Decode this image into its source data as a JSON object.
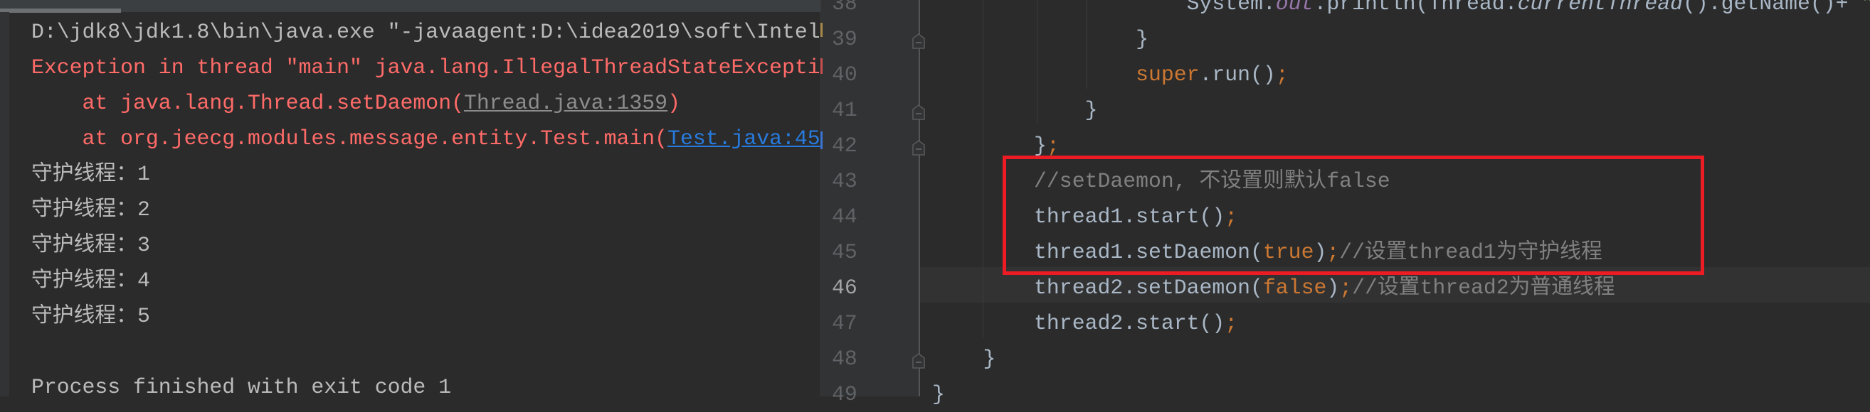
{
  "console": {
    "lines": [
      {
        "parts": [
          {
            "text": "D:\\jdk8\\jdk1.8\\bin\\java.exe \"-javaagent:D:\\idea2019\\soft\\Intel",
            "kind": "normal"
          }
        ]
      },
      {
        "parts": [
          {
            "text": "Exception in thread \"main\" java.lang.IllegalThreadStateException",
            "kind": "error"
          }
        ]
      },
      {
        "parts": [
          {
            "text": "    at java.lang.Thread.setDaemon(",
            "kind": "error"
          },
          {
            "text": "Thread.java:1359",
            "kind": "link-gray"
          },
          {
            "text": ")",
            "kind": "error"
          }
        ]
      },
      {
        "parts": [
          {
            "text": "    at org.jeecg.modules.message.entity.Test.main(",
            "kind": "error"
          },
          {
            "text": "Test.java:45",
            "kind": "link-blue"
          }
        ]
      },
      {
        "parts": [
          {
            "text": "守护线程：1",
            "kind": "normal"
          }
        ]
      },
      {
        "parts": [
          {
            "text": "守护线程：2",
            "kind": "normal"
          }
        ]
      },
      {
        "parts": [
          {
            "text": "守护线程：3",
            "kind": "normal"
          }
        ]
      },
      {
        "parts": [
          {
            "text": "守护线程：4",
            "kind": "normal"
          }
        ]
      },
      {
        "parts": [
          {
            "text": "守护线程：5",
            "kind": "normal"
          }
        ]
      },
      {
        "parts": []
      },
      {
        "parts": [
          {
            "text": "Process finished with exit code 1",
            "kind": "normal"
          }
        ]
      }
    ]
  },
  "editor": {
    "current_line": "46",
    "highlight_box_color": "#ed1c24",
    "lines": [
      {
        "number": "38",
        "fold": false,
        "tokens": [
          {
            "text": "                    System.",
            "kind": "plain"
          },
          {
            "text": "out",
            "kind": "field"
          },
          {
            "text": ".println(Thread.",
            "kind": "plain"
          },
          {
            "text": "currentThread",
            "kind": "italic"
          },
          {
            "text": "().getName()+ ",
            "kind": "plain"
          },
          {
            "text": "\"",
            "kind": "string"
          }
        ]
      },
      {
        "number": "39",
        "fold": true,
        "tokens": [
          {
            "text": "                }",
            "kind": "plain"
          }
        ]
      },
      {
        "number": "40",
        "fold": false,
        "tokens": [
          {
            "text": "                ",
            "kind": "plain"
          },
          {
            "text": "super",
            "kind": "keyword"
          },
          {
            "text": ".run()",
            "kind": "plain"
          },
          {
            "text": ";",
            "kind": "keyword"
          }
        ]
      },
      {
        "number": "41",
        "fold": true,
        "tokens": [
          {
            "text": "            }",
            "kind": "plain"
          }
        ]
      },
      {
        "number": "42",
        "fold": true,
        "tokens": [
          {
            "text": "        }",
            "kind": "plain"
          },
          {
            "text": ";",
            "kind": "keyword"
          }
        ]
      },
      {
        "number": "43",
        "fold": false,
        "tokens": [
          {
            "text": "        //setDaemon, 不设置则默认false",
            "kind": "comment"
          }
        ]
      },
      {
        "number": "44",
        "fold": false,
        "tokens": [
          {
            "text": "        thread1.start()",
            "kind": "plain"
          },
          {
            "text": ";",
            "kind": "keyword"
          }
        ]
      },
      {
        "number": "45",
        "fold": false,
        "tokens": [
          {
            "text": "        thread1.setDaemon(",
            "kind": "plain"
          },
          {
            "text": "true",
            "kind": "keyword"
          },
          {
            "text": ")",
            "kind": "plain"
          },
          {
            "text": ";",
            "kind": "keyword"
          },
          {
            "text": "//设置thread1为守护线程",
            "kind": "comment"
          }
        ]
      },
      {
        "number": "46",
        "fold": false,
        "tokens": [
          {
            "text": "        thread2.setDaemon(",
            "kind": "plain"
          },
          {
            "text": "false",
            "kind": "keyword"
          },
          {
            "text": ")",
            "kind": "plain"
          },
          {
            "text": ";",
            "kind": "keyword"
          },
          {
            "text": "//设置thread2为普通线程",
            "kind": "comment"
          }
        ]
      },
      {
        "number": "47",
        "fold": false,
        "tokens": [
          {
            "text": "        thread2.start()",
            "kind": "plain"
          },
          {
            "text": ";",
            "kind": "keyword"
          }
        ]
      },
      {
        "number": "48",
        "fold": true,
        "tokens": [
          {
            "text": "    }",
            "kind": "plain"
          }
        ]
      },
      {
        "number": "49",
        "fold": false,
        "tokens": [
          {
            "text": "}",
            "kind": "plain"
          }
        ]
      }
    ]
  }
}
